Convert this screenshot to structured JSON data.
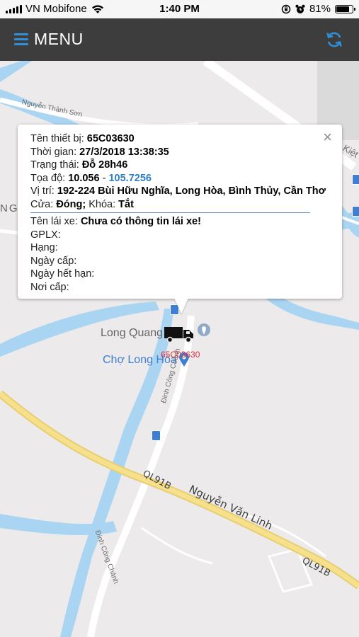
{
  "status_bar": {
    "carrier": "VN Mobifone",
    "time": "1:40 PM",
    "battery": "81%",
    "battery_level": 0.81
  },
  "header": {
    "menu_label": "MENU",
    "menu_icon": "hamburger-icon",
    "refresh_icon": "refresh-icon"
  },
  "popup": {
    "device_label": "Tên thiết bị:",
    "device_value": "65C03630",
    "time_label": "Thời gian:",
    "time_value": "27/3/2018 13:38:35",
    "state_label": "Trạng thái:",
    "state_value": "Đỗ 28h46",
    "coord_label": "Tọa độ:",
    "coord_lat": "10.056",
    "coord_sep": "-",
    "coord_lng": "105.7256",
    "location_label": "Vị trí:",
    "location_value": "192-224 Bùi Hữu Nghĩa, Long Hòa, Bình Thủy, Cần Thơ",
    "door_label": "Cửa:",
    "door_value": "Đóng;",
    "lock_label": "Khóa:",
    "lock_value": "Tắt",
    "driver_label": "Tên lái xe:",
    "driver_value": "Chưa có thông tin lái xe!",
    "license_label": "GPLX:",
    "class_label": "Hạng:",
    "issue_date_label": "Ngày cấp:",
    "expiry_label": "Ngày hết hạn:",
    "issue_place_label": "Nơi cấp:",
    "close": "×"
  },
  "map": {
    "labels": {
      "nguyen_thanh": "Nguyễn Thành Sơn",
      "kiet": "Kiệt",
      "ng": "NG",
      "long_quang": "Long Quang",
      "cho_long_hoa": "Chợ Long Hòa",
      "dinh_cong_chanh_1": "Đinh Công Chánh",
      "dinh_cong_chanh_2": "Đinh Công Chánh",
      "dinh_cong_chanh_3": "Đinh Công Chánh",
      "ql91b_1": "QL91B",
      "nguyen_van_linh": "Nguyễn Văn Linh",
      "ql91b_2": "QL91B"
    },
    "vehicle_plate": "65C03630",
    "colors": {
      "water": "#a9d5f2",
      "land": "#eceaea",
      "highway": "#f7e08c"
    }
  }
}
